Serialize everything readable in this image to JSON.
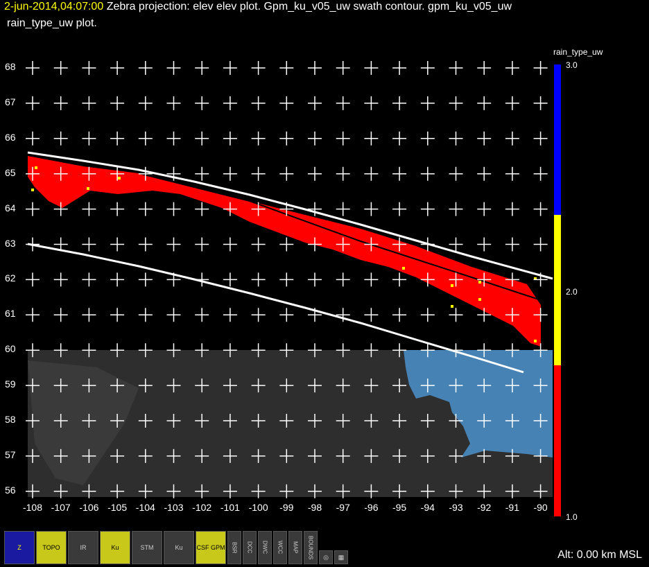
{
  "title": {
    "timestamp": "2-jun-2014,04:07:00",
    "line1_rest": "Zebra projection: elev elev  plot.  Gpm_ku_v05_uw swath contour.  gpm_ku_v05_uw",
    "line2": "rain_type_uw  plot."
  },
  "axes": {
    "y_ticks": [
      "68",
      "67",
      "66",
      "65",
      "64",
      "63",
      "62",
      "61",
      "60",
      "59",
      "58",
      "57",
      "56"
    ],
    "x_ticks": [
      "-108",
      "-107",
      "-106",
      "-105",
      "-104",
      "-103",
      "-102",
      "-101",
      "-100",
      "-99",
      "-98",
      "-97",
      "-96",
      "-95",
      "-94",
      "-93",
      "-92",
      "-91",
      "-90"
    ],
    "lon_range": [
      -108,
      -90
    ],
    "lat_range": [
      56,
      68
    ]
  },
  "colorbar": {
    "title": "rain_type_uw",
    "ticks": [
      "3.0",
      "2.0",
      "1.0"
    ],
    "colors": [
      "#0000ff",
      "#ffff00",
      "#ff0000"
    ]
  },
  "altitude": "Alt: 0.00 km MSL",
  "toolbar": {
    "icons": [
      {
        "name": "zebra-logo-icon",
        "label": "Z"
      },
      {
        "name": "topo-icon",
        "label": "TOPO"
      },
      {
        "name": "ir-icon",
        "label": "IR"
      },
      {
        "name": "ku-icon",
        "label": "Ku"
      },
      {
        "name": "stm-icon",
        "label": "STM"
      },
      {
        "name": "ku-v5-icon",
        "label": "Ku"
      },
      {
        "name": "csf-gpm-icon",
        "label": "CSF GPM"
      },
      {
        "name": "bsr-icon",
        "label": "BSR"
      },
      {
        "name": "dcc-icon",
        "label": "DCC"
      },
      {
        "name": "dwc-icon",
        "label": "DWC"
      },
      {
        "name": "wcc-icon",
        "label": "WCC"
      },
      {
        "name": "map-icon",
        "label": "MAP"
      },
      {
        "name": "bounds-icon",
        "label": "BOUNDS"
      },
      {
        "name": "circle-icon",
        "label": "◎"
      },
      {
        "name": "grid-icon",
        "label": "▦"
      }
    ]
  },
  "colors": {
    "land": "#2e2e2e",
    "water": "#4682b4",
    "swath": "#ffffff",
    "rain_stratiform": "#ff0000",
    "rain_convective": "#ffff00"
  }
}
